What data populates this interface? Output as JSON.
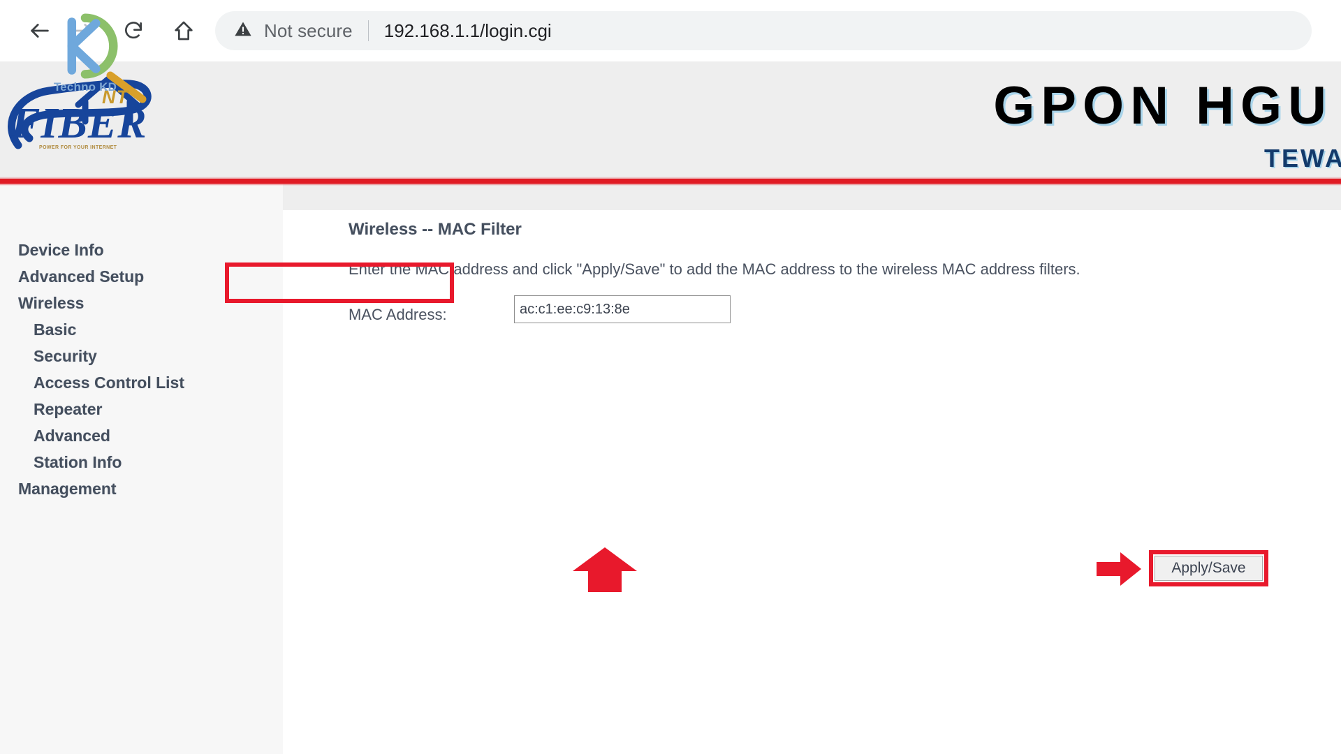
{
  "browser": {
    "back_icon": "back-arrow-icon",
    "forward_icon": "forward-arrow-icon",
    "reload_icon": "reload-icon",
    "home_icon": "home-icon",
    "security_icon": "not-secure-warning-icon",
    "security_label": "Not secure",
    "url": "192.168.1.1/login.cgi"
  },
  "watermark": {
    "text": "Techno KD",
    "icon": "techno-kd-logo-icon"
  },
  "header": {
    "brand_name": "FIBER",
    "brand_sub": "POWER FOR YOUR INTERNET",
    "brand_badge": "NT",
    "title": "GPON HGU",
    "vendor": "TEWA",
    "accent_color": "#e01b24",
    "title_shadow_color": "#a8d4ea",
    "banner_bg": "#eeeeee"
  },
  "sidebar": {
    "items": [
      {
        "label": "Device Info",
        "level": 0
      },
      {
        "label": "Advanced Setup",
        "level": 0
      },
      {
        "label": "Wireless",
        "level": 0
      },
      {
        "label": "Basic",
        "level": 1
      },
      {
        "label": "Security",
        "level": 1
      },
      {
        "label": "Access Control List",
        "level": 1
      },
      {
        "label": "Repeater",
        "level": 1
      },
      {
        "label": "Advanced",
        "level": 1
      },
      {
        "label": "Station Info",
        "level": 1
      },
      {
        "label": "Management",
        "level": 0
      }
    ]
  },
  "main": {
    "title": "Wireless -- MAC Filter",
    "description": "Enter the MAC address and click \"Apply/Save\" to add the MAC address to the wireless MAC address filters.",
    "mac_label": "MAC Address:",
    "mac_value": "ac:c1:ee:c9:13:8e",
    "mac_placeholder": "",
    "apply_label": "Apply/Save",
    "highlight_color": "#e8192c",
    "annotations": [
      {
        "name": "arrow-pointing-to-mac-field",
        "direction": "up",
        "color": "#e8192c"
      },
      {
        "name": "arrow-pointing-to-apply-button",
        "direction": "right",
        "color": "#e8192c"
      }
    ]
  }
}
